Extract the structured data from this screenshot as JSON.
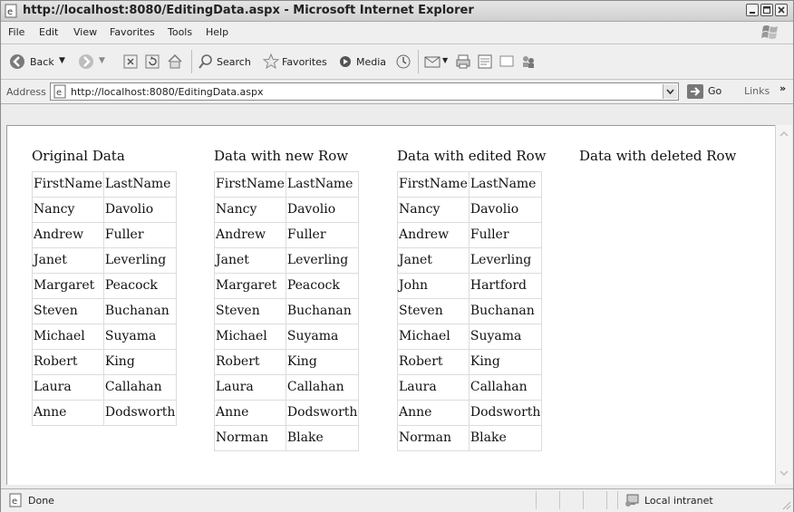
{
  "window": {
    "title": "http://localhost:8080/EditingData.aspx - Microsoft Internet Explorer"
  },
  "menu": [
    "File",
    "Edit",
    "View",
    "Favorites",
    "Tools",
    "Help"
  ],
  "toolbar": {
    "back": "Back",
    "search": "Search",
    "favorites": "Favorites",
    "media": "Media"
  },
  "address": {
    "label": "Address",
    "url": "http://localhost:8080/EditingData.aspx",
    "go": "Go",
    "links": "Links",
    "more": "»"
  },
  "page": {
    "sections": [
      {
        "heading": "Original Data",
        "columns": [
          "FirstName",
          "LastName"
        ],
        "rows": [
          [
            "Nancy",
            "Davolio"
          ],
          [
            "Andrew",
            "Fuller"
          ],
          [
            "Janet",
            "Leverling"
          ],
          [
            "Margaret",
            "Peacock"
          ],
          [
            "Steven",
            "Buchanan"
          ],
          [
            "Michael",
            "Suyama"
          ],
          [
            "Robert",
            "King"
          ],
          [
            "Laura",
            "Callahan"
          ],
          [
            "Anne",
            "Dodsworth"
          ]
        ]
      },
      {
        "heading": "Data with new Row",
        "columns": [
          "FirstName",
          "LastName"
        ],
        "rows": [
          [
            "Nancy",
            "Davolio"
          ],
          [
            "Andrew",
            "Fuller"
          ],
          [
            "Janet",
            "Leverling"
          ],
          [
            "Margaret",
            "Peacock"
          ],
          [
            "Steven",
            "Buchanan"
          ],
          [
            "Michael",
            "Suyama"
          ],
          [
            "Robert",
            "King"
          ],
          [
            "Laura",
            "Callahan"
          ],
          [
            "Anne",
            "Dodsworth"
          ],
          [
            "Norman",
            "Blake"
          ]
        ]
      },
      {
        "heading": "Data with edited Row",
        "columns": [
          "FirstName",
          "LastName"
        ],
        "rows": [
          [
            "Nancy",
            "Davolio"
          ],
          [
            "Andrew",
            "Fuller"
          ],
          [
            "Janet",
            "Leverling"
          ],
          [
            "John",
            "Hartford"
          ],
          [
            "Steven",
            "Buchanan"
          ],
          [
            "Michael",
            "Suyama"
          ],
          [
            "Robert",
            "King"
          ],
          [
            "Laura",
            "Callahan"
          ],
          [
            "Anne",
            "Dodsworth"
          ],
          [
            "Norman",
            "Blake"
          ]
        ]
      },
      {
        "heading": "Data with deleted Row",
        "columns": [],
        "rows": []
      }
    ]
  },
  "status": {
    "text": "Done",
    "zone": "Local intranet"
  }
}
